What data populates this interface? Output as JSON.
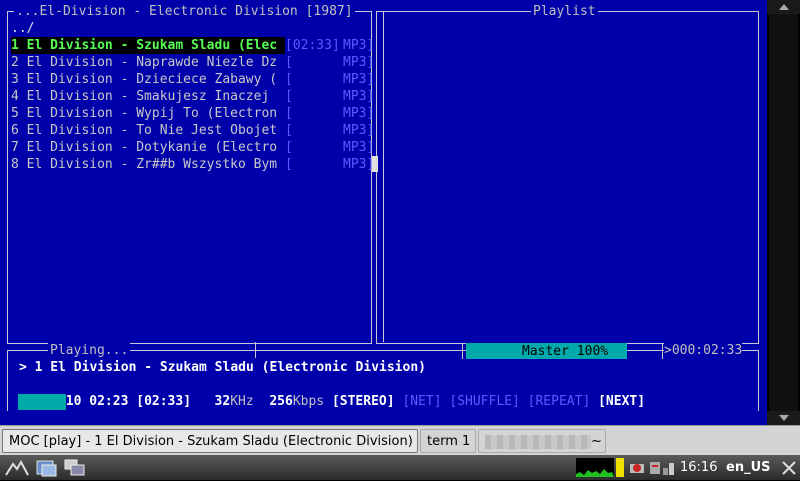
{
  "browser_pane": {
    "title": "...El-Division - Electronic Division [1987]",
    "parent_dir": "../",
    "tracks": [
      {
        "name": "1 El Division - Szukam Sladu (Elec",
        "time": "[02:33]",
        "format": "MP3]",
        "selected": true
      },
      {
        "name": "2 El Division - Naprawde Niezle Dz",
        "time": "[",
        "format": "MP3]",
        "selected": false
      },
      {
        "name": "3 El Division - Dzieciece Zabawy (",
        "time": "[",
        "format": "MP3]",
        "selected": false
      },
      {
        "name": "4 El Division - Smakujesz Inaczej ",
        "time": "[",
        "format": "MP3]",
        "selected": false
      },
      {
        "name": "5 El Division - Wypij To (Electron",
        "time": "[",
        "format": "MP3]",
        "selected": false
      },
      {
        "name": "6 El Division - To Nie Jest Obojet",
        "time": "[",
        "format": "MP3]",
        "selected": false
      },
      {
        "name": "7 El Division - Dotykanie (Electro",
        "time": "[",
        "format": "MP3]",
        "selected": false
      },
      {
        "name": "8 El Division - Zr##b Wszystko Bym",
        "time": "[",
        "format": "MP3]",
        "selected": false
      }
    ]
  },
  "playlist_pane": {
    "title": "Playlist"
  },
  "status": {
    "state": "Playing...",
    "mixer": "Master 100%",
    "total_time": ">000:02:33",
    "now_playing": "> 1 El Division - Szukam Sladu (Electronic Division)",
    "elapsed": "00:10",
    "remaining": "02:23",
    "duration": "[02:33]",
    "rate_value": "32",
    "rate_unit": "KHz",
    "bitrate_value": "256",
    "bitrate_unit": "Kbps",
    "flags": [
      {
        "label": "[STEREO]",
        "active": true
      },
      {
        "label": "[NET]",
        "active": false
      },
      {
        "label": "[SHUFFLE]",
        "active": false
      },
      {
        "label": "[REPEAT]",
        "active": false
      },
      {
        "label": "[NEXT]",
        "active": true
      }
    ],
    "progress_fraction": 0.065
  },
  "taskbar": {
    "tasks": [
      {
        "label": "MOC [play] - 1 El Division - Szukam Sladu (Electronic Division)",
        "active": true
      },
      {
        "label": "term 1",
        "active": false
      },
      {
        "label": "~",
        "active": false
      }
    ]
  },
  "panel": {
    "clock": "16:16",
    "locale": "en_US"
  },
  "colors": {
    "terminal_bg": "#0000aa",
    "selected_text": "#55ff55",
    "dim_tag": "#5a5aff",
    "progress": "#00aaaa"
  }
}
